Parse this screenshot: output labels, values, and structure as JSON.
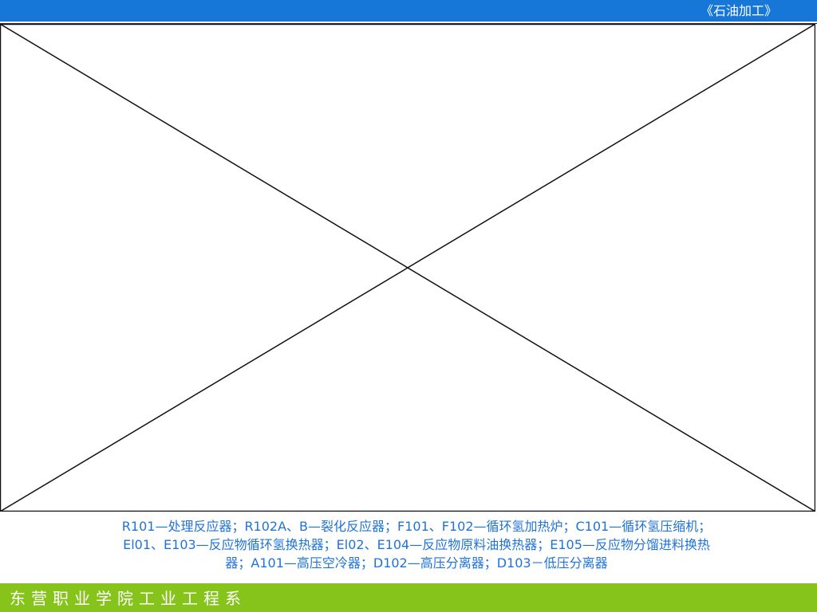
{
  "header": {
    "course_title": "《石油加工》"
  },
  "figure": {
    "type": "missing-image-placeholder"
  },
  "caption": {
    "lines": [
      "R101—处理反应器；R102A、B—裂化反应器；F101、F102—循环氢加热炉；C101—循环氢压缩机；",
      "El01、E103—反应物循环氢换热器；El02、E104—反应物原料油换热器；E105—反应物分馏进料换热",
      "器；A101—高压空冷器；D102—高压分离器；D103－低压分离器"
    ]
  },
  "footer": {
    "institution": "东营职业学院工业工程系"
  },
  "colors": {
    "header_bar": "#1677d9",
    "footer_bar": "#86c41c",
    "caption_text": "#1f73d6"
  }
}
